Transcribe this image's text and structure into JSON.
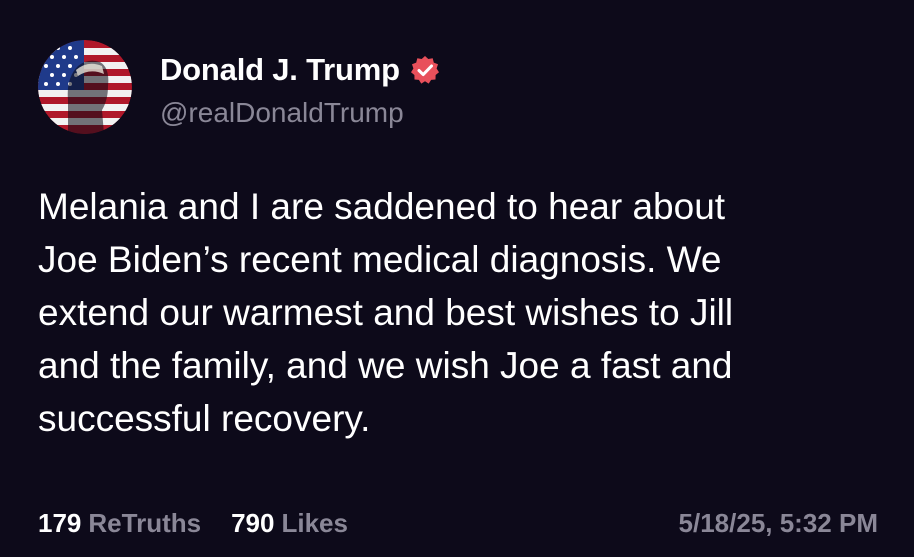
{
  "author": {
    "display_name": "Donald J. Trump",
    "handle": "@realDonaldTrump",
    "avatar_icon": "flag-portrait-avatar",
    "verified_icon": "verified-badge-icon",
    "verified_color": "#e8505b"
  },
  "post": {
    "lines": [
      "Melania and I are saddened to hear about",
      "Joe Biden’s recent medical diagnosis. We",
      "extend our warmest and best wishes to Jill",
      "and the family, and we wish Joe a fast and",
      "successful recovery."
    ]
  },
  "stats": {
    "retruths_count": "179",
    "retruths_label": "ReTruths",
    "likes_count": "790",
    "likes_label": "Likes",
    "timestamp": "5/18/25, 5:32 PM"
  },
  "colors": {
    "background": "#0d0a1a",
    "text_primary": "#ffffff",
    "text_secondary": "#8a8797"
  }
}
